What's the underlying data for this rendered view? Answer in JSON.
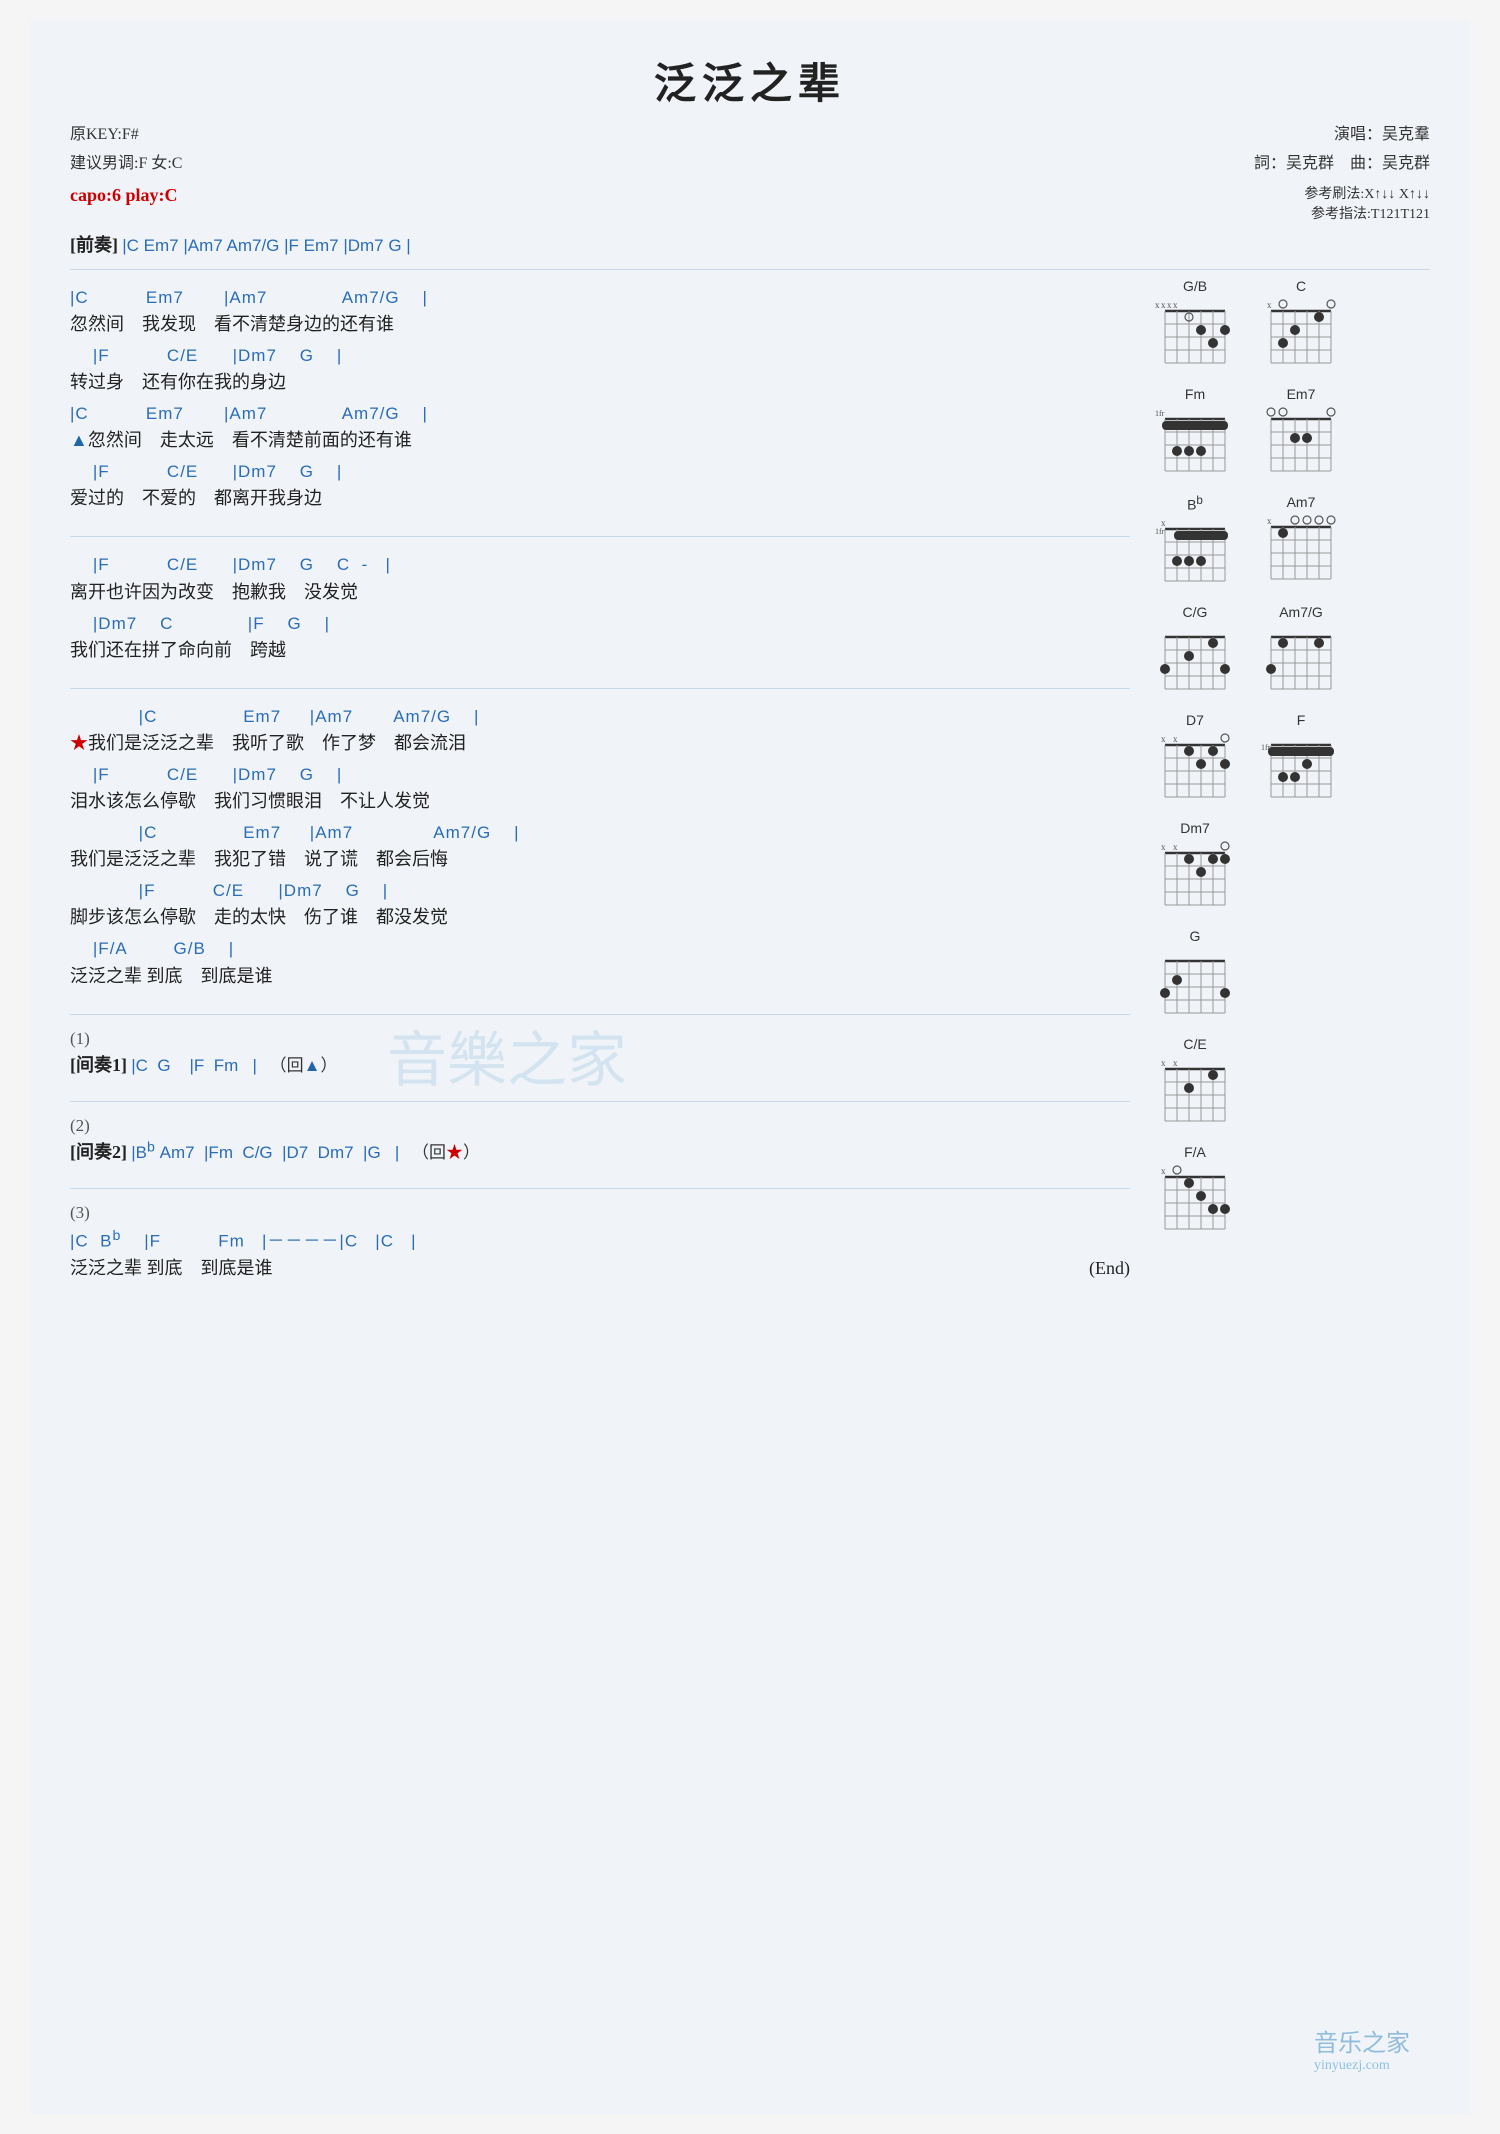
{
  "title": "泛泛之辈",
  "keyInfo": {
    "originalKey": "原KEY:F#",
    "recommendedKey": "建议男调:F 女:C",
    "capo": "capo:6 play:C"
  },
  "performerInfo": {
    "singer": "演唱：吴克羣",
    "lyricist": "詞：吴克群",
    "composer": "曲：吴克群"
  },
  "refInfo": {
    "strumPattern": "参考刷法:X↑↓↓ X↑↓↓",
    "fingerPattern": "参考指法:T121T121"
  },
  "prelude": {
    "label": "[前奏]",
    "chords": "|C    Em7    |Am7  Am7/G   |F   Em7   |Dm7   G   |"
  },
  "sections": [
    {
      "chords": "|C          Em7       |Am7              Am7/G    |",
      "lyrics": "忽然间    我发现    看不清楚身边的还有谁"
    },
    {
      "chords": "    |F          C/E      |Dm7    G    |",
      "lyrics": "转过身    还有你在我的身边"
    },
    {
      "chords": "|C          Em7       |Am7              Am7/G    |",
      "lyrics": "▲忽然间    走太远    看不清楚前面的还有谁",
      "hasArrow": true
    },
    {
      "chords": "    |F          C/E      |Dm7    G    |",
      "lyrics": "爱过的    不爱的    都离开我身边"
    }
  ],
  "sections2": [
    {
      "chords": "    |F          C/E      |Dm7    G    C  -   |",
      "lyrics": "离开也许因为改变    抱歉我    没发觉"
    },
    {
      "chords": "    |Dm7    C             |F    G    |",
      "lyrics": "我们还在拼了命向前    跨越"
    }
  ],
  "sections3": [
    {
      "chords": "            |C               Em7      |Am7       Am7/G    |",
      "lyrics": "★我们是泛泛之辈    我听了歌    作了梦    都会流泪",
      "hasStar": true
    },
    {
      "chords": "    |F          C/E      |Dm7    G    |",
      "lyrics": "泪水该怎么停歇    我们习惯眼泪    不让人发觉"
    },
    {
      "chords": "            |C               Em7      |Am7              Am7/G    |",
      "lyrics": "我们是泛泛之辈    我犯了错    说了谎    都会后悔"
    },
    {
      "chords": "            |F          C/E      |Dm7    G    |",
      "lyrics": "脚步该怎么停歇    走的太快    伤了谁    都没发觉"
    },
    {
      "chords": "    |F/A        G/B    |",
      "lyrics": "泛泛之辈 到底    到底是谁"
    }
  ],
  "interlude1": {
    "num": "(1)",
    "label": "[间奏1]",
    "chords": "|C   G    |F   Fm   |",
    "note": "（回▲）"
  },
  "interlude2": {
    "num": "(2)",
    "label": "[间奏2]",
    "chords": "|Bᵇ  Am7  |Fm  C/G  |D7  Dm7  |G   |",
    "note": "（回★）"
  },
  "ending": {
    "num": "(3)",
    "line1chords": "|C   Bᵇ   |F          Fm   |－－－－|C   |C   |",
    "line1lyrics": "泛泛之辈 到底    到底是谁",
    "line1note": "(End)"
  },
  "chordDiagrams": [
    {
      "name": "G/B",
      "fret": 0,
      "capoMark": false,
      "xStrings": [
        0,
        1
      ],
      "openStrings": [],
      "dots": [
        [
          2,
          2
        ],
        [
          3,
          1
        ],
        [
          4,
          1
        ]
      ],
      "barres": []
    },
    {
      "name": "C",
      "fret": 0,
      "xStrings": [
        0
      ],
      "openStrings": [
        1,
        2
      ],
      "dots": [
        [
          2,
          2
        ],
        [
          3,
          1
        ],
        [
          4,
          0
        ]
      ],
      "barres": []
    },
    {
      "name": "Fm",
      "fret": 1,
      "xStrings": [
        0,
        1
      ],
      "openStrings": [],
      "dots": [
        [
          1,
          1
        ],
        [
          2,
          3
        ],
        [
          3,
          3
        ],
        [
          4,
          3
        ],
        [
          5,
          1
        ],
        [
          6,
          1
        ]
      ],
      "barres": [
        [
          1,
          1,
          6
        ]
      ]
    },
    {
      "name": "Em7",
      "fret": 0,
      "xStrings": [],
      "openStrings": [
        1,
        2
      ],
      "dots": [
        [
          2,
          2
        ],
        [
          3,
          2
        ],
        [
          4,
          0
        ],
        [
          5,
          0
        ],
        [
          6,
          0
        ]
      ],
      "barres": []
    },
    {
      "name": "Bb",
      "fret": 1,
      "xStrings": [
        0,
        1
      ],
      "openStrings": [],
      "dots": [
        [
          1,
          1
        ],
        [
          2,
          3
        ],
        [
          3,
          3
        ],
        [
          4,
          3
        ],
        [
          5,
          1
        ]
      ],
      "barres": [
        [
          1,
          1,
          5
        ]
      ]
    },
    {
      "name": "Am7",
      "fret": 0,
      "xStrings": [
        0
      ],
      "openStrings": [
        1,
        2,
        3
      ],
      "dots": [
        [
          2,
          1
        ],
        [
          3,
          0
        ],
        [
          4,
          0
        ],
        [
          5,
          0
        ]
      ],
      "barres": []
    },
    {
      "name": "C/G",
      "fret": 0,
      "xStrings": [],
      "openStrings": [],
      "dots": [
        [
          1,
          3
        ],
        [
          2,
          2
        ],
        [
          3,
          0
        ],
        [
          4,
          1
        ],
        [
          5,
          0
        ],
        [
          6,
          3
        ]
      ],
      "barres": []
    },
    {
      "name": "Am7/G",
      "fret": 0,
      "xStrings": [],
      "openStrings": [],
      "dots": [
        [
          1,
          3
        ],
        [
          2,
          1
        ],
        [
          3,
          0
        ],
        [
          4,
          0
        ],
        [
          5,
          0
        ],
        [
          6,
          0
        ]
      ],
      "barres": []
    },
    {
      "name": "D7",
      "fret": 0,
      "xStrings": [
        0,
        1
      ],
      "openStrings": [
        1
      ],
      "dots": [
        [
          2,
          1
        ],
        [
          3,
          2
        ],
        [
          4,
          1
        ],
        [
          5,
          2
        ]
      ],
      "barres": []
    },
    {
      "name": "F",
      "fret": 1,
      "xStrings": [],
      "openStrings": [],
      "dots": [
        [
          1,
          1
        ],
        [
          2,
          1
        ],
        [
          3,
          2
        ],
        [
          4,
          3
        ],
        [
          5,
          3
        ],
        [
          6,
          1
        ]
      ],
      "barres": [
        [
          1,
          1,
          6
        ]
      ]
    },
    {
      "name": "Dm7",
      "fret": 0,
      "xStrings": [
        0,
        1
      ],
      "openStrings": [
        1
      ],
      "dots": [
        [
          2,
          1
        ],
        [
          3,
          2
        ],
        [
          4,
          1
        ],
        [
          5,
          0
        ]
      ],
      "barres": []
    },
    {
      "name": "G",
      "fret": 0,
      "xStrings": [],
      "openStrings": [],
      "dots": [
        [
          1,
          3
        ],
        [
          2,
          0
        ],
        [
          3,
          0
        ],
        [
          4,
          0
        ],
        [
          5,
          2
        ],
        [
          6,
          3
        ]
      ],
      "barres": []
    },
    {
      "name": "C/E",
      "fret": 0,
      "xStrings": [
        0,
        1
      ],
      "openStrings": [],
      "dots": [
        [
          2,
          2
        ],
        [
          3,
          1
        ],
        [
          4,
          0
        ],
        [
          5,
          0
        ],
        [
          6,
          0
        ]
      ],
      "barres": []
    },
    {
      "name": "F/A",
      "fret": 0,
      "xStrings": [
        0
      ],
      "openStrings": [],
      "dots": [
        [
          2,
          1
        ],
        [
          3,
          2
        ],
        [
          4,
          3
        ],
        [
          5,
          3
        ],
        [
          6,
          0
        ]
      ],
      "barres": []
    }
  ],
  "watermark": "音 樂 之 家",
  "watermarkUrl": "yinyuezj.com"
}
